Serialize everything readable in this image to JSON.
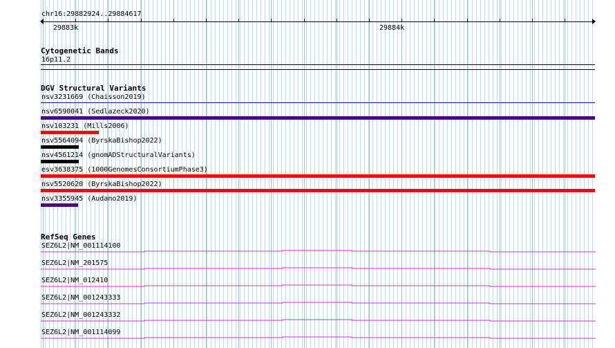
{
  "ruler": {
    "region": "chr16:29882924..29884617",
    "ticks": [
      "29883k",
      "29884k"
    ]
  },
  "cytoband": {
    "title": "Cytogenetic Bands",
    "band": "16p11.2"
  },
  "dgv": {
    "title": "DGV Structural Variants",
    "variants": [
      {
        "label": "nsv3231669 (Chaisson2019)",
        "color": "#000080"
      },
      {
        "label": "nsv6590041 (Sedlazeck2020)",
        "color": "#4b0082"
      },
      {
        "label": "nsv103231 (Mills2006)",
        "color": "#ff0000"
      },
      {
        "label": "nsv5564094 (ByrskaBishop2022)",
        "color": "#000000"
      },
      {
        "label": "nsv4561214 (gnomADStructuralVariants)",
        "color": "#000000"
      },
      {
        "label": "esv3638375 (1000GenomesConsortiumPhase3)",
        "color": "#ff0000"
      },
      {
        "label": "nsv5520620 (ByrskaBishop2022)",
        "color": "#ff0000"
      },
      {
        "label": "nsv3355945 (Audano2019)",
        "color": "#4b0082"
      }
    ]
  },
  "refseq": {
    "title": "RefSeq Genes",
    "color": "#cc33cc",
    "genes": [
      {
        "label": "SEZ6L2|NM_001114100"
      },
      {
        "label": "SEZ6L2|NM_201575"
      },
      {
        "label": "SEZ6L2|NM_012410"
      },
      {
        "label": "SEZ6L2|NM_001243333"
      },
      {
        "label": "SEZ6L2|NM_001243332"
      },
      {
        "label": "SEZ6L2|NM_001114099"
      }
    ]
  }
}
